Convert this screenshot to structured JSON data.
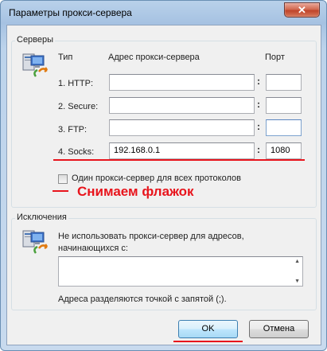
{
  "window": {
    "title": "Параметры прокси-сервера",
    "close_glyph": "✕"
  },
  "servers": {
    "group_title": "Серверы",
    "col_type": "Тип",
    "col_address": "Адрес прокси-сервера",
    "col_port": "Порт",
    "rows": [
      {
        "label": "1. HTTP:",
        "address": "",
        "port": ""
      },
      {
        "label": "2. Secure:",
        "address": "",
        "port": ""
      },
      {
        "label": "3. FTP:",
        "address": "",
        "port": ""
      },
      {
        "label": "4. Socks:",
        "address": "192.168.0.1",
        "port": "1080"
      }
    ],
    "colon": ":",
    "same_proxy_checkbox": {
      "label": "Один прокси-сервер для всех протоколов",
      "checked": false
    }
  },
  "annotation": {
    "text": "Снимаем флажок",
    "color": "#e8141c"
  },
  "exceptions": {
    "group_title": "Исключения",
    "description": "Не использовать прокси-сервер для адресов, начинающихся с:",
    "value": "",
    "hint": "Адреса разделяются точкой с запятой (;)."
  },
  "buttons": {
    "ok": "OK",
    "cancel": "Отмена"
  },
  "icons": {
    "servers": "computer-network-icon",
    "exceptions": "computer-network-icon"
  }
}
